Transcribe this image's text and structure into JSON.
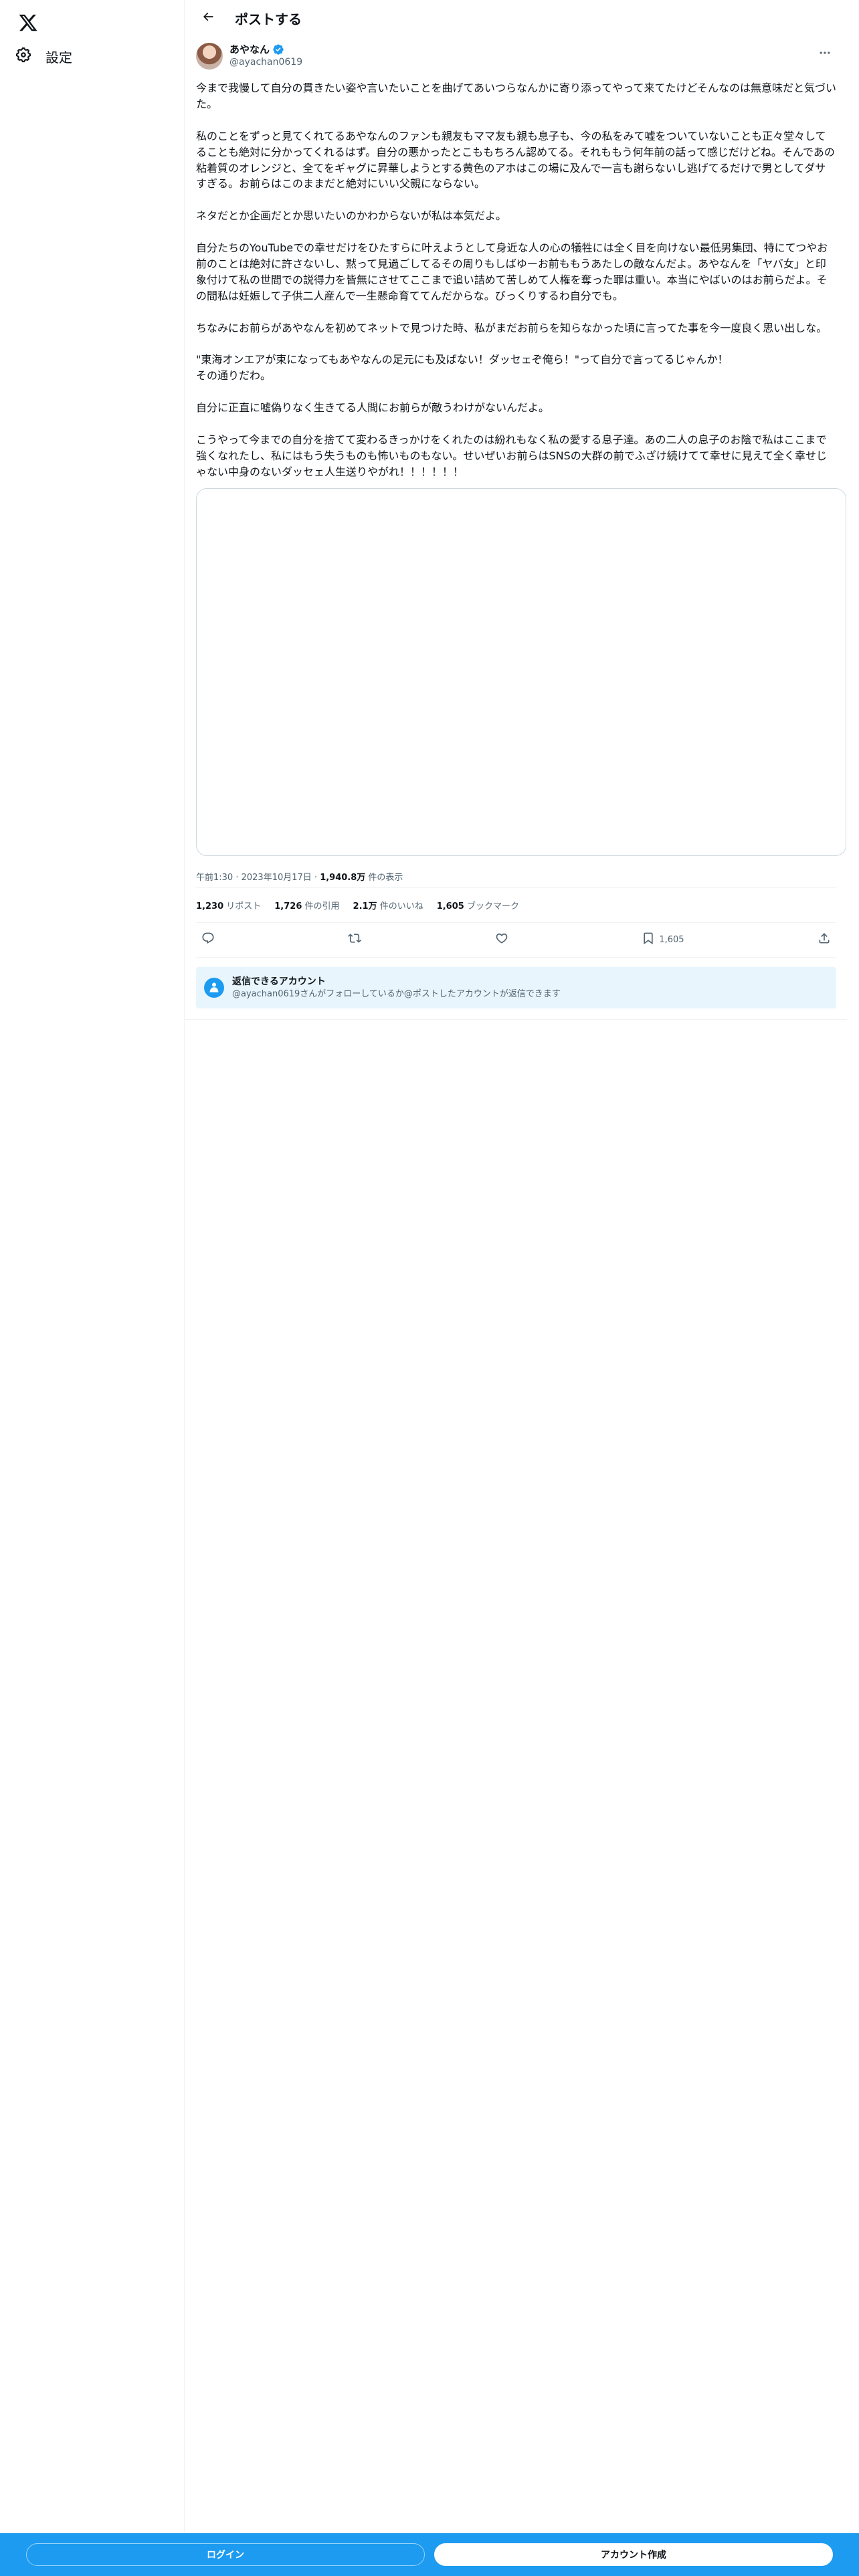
{
  "sidebar": {
    "logo_icon": "x-logo-icon",
    "settings_label": "設定",
    "settings_icon": "gear-icon"
  },
  "header": {
    "back_icon": "arrow-left-icon",
    "title": "ポストする"
  },
  "tweet": {
    "author": {
      "display_name": "あやなん",
      "handle": "@ayachan0619",
      "verified": true,
      "verified_color": "#1d9bf0"
    },
    "more_icon": "more-dots-icon",
    "text": "今まで我慢して自分の貫きたい姿や言いたいことを曲げてあいつらなんかに寄り添ってやって来てたけどそんなのは無意味だと気づいた。\n\n私のことをずっと見てくれてるあやなんのファンも親友もママ友も親も息子も、今の私をみて嘘をついていないことも正々堂々してることも絶対に分かってくれるはず。自分の悪かったとこももちろん認めてる。それももう何年前の話って感じだけどね。そんであの粘着質のオレンジと、全てをギャグに昇華しようとする黄色のアホはこの場に及んで一言も謝らないし逃げてるだけで男としてダサすぎる。お前らはこのままだと絶対にいい父親にならない。\n\nネタだとか企画だとか思いたいのかわからないが私は本気だよ。\n\n自分たちのYouTubeでの幸せだけをひたすらに叶えようとして身近な人の心の犠牲には全く目を向けない最低男集団、特にてつやお前のことは絶対に許さないし、黙って見過ごしてるその周りもしばゆーお前ももうあたしの敵なんだよ。あやなんを「ヤバ女」と印象付けて私の世間での説得力を皆無にさせてここまで追い詰めて苦しめて人権を奪った罪は重い。本当にやばいのはお前らだよ。その間私は妊娠して子供二人産んで一生懸命育ててんだからな。びっくりするわ自分でも。\n\nちなみにお前らがあやなんを初めてネットで見つけた時、私がまだお前らを知らなかった頃に言ってた事を今一度良く思い出しな。\n\n\"東海オンエアが束になってもあやなんの足元にも及ばない！ダッセェぞ俺ら！\"って自分で言ってるじゃんか！\nその通りだわ。\n\n自分に正直に嘘偽りなく生きてる人間にお前らが敵うわけがないんだよ。\n\nこうやって今までの自分を捨てて変わるきっかけをくれたのは紛れもなく私の愛する息子達。あの二人の息子のお陰で私はここまで強くなれたし、私にはもう失うものも怖いものもない。せいぜいお前らはSNSの大群の前でふざけ続けてて幸せに見えて全く幸せじゃない中身のないダッセェ人生送りやがれ！！！！！！",
    "time": "午前1:30",
    "date": "2023年10月17日",
    "views_count": "1,940.8万",
    "views_label": " 件の表示",
    "separator": " · ",
    "stats": {
      "reposts_count": "1,230",
      "reposts_label": " リポスト",
      "quotes_count": "1,726",
      "quotes_label": " 件の引用",
      "likes_count": "2.1万",
      "likes_label": " 件のいいね",
      "bookmarks_count": "1,605",
      "bookmarks_label": " ブックマーク"
    },
    "actions": {
      "reply_icon": "reply-icon",
      "repost_icon": "repost-icon",
      "like_icon": "heart-icon",
      "bookmark_icon": "bookmark-icon",
      "bookmark_count": "1,605",
      "share_icon": "share-icon"
    }
  },
  "reply_restriction": {
    "icon": "mention-person-icon",
    "title": "返信できるアカウント",
    "description": "@ayachan0619さんがフォローしているか@ポストしたアカウントが返信できます"
  },
  "bottom_bar": {
    "login_label": "ログイン",
    "signup_label": "アカウント作成",
    "bg_color": "#1d9bf0"
  }
}
